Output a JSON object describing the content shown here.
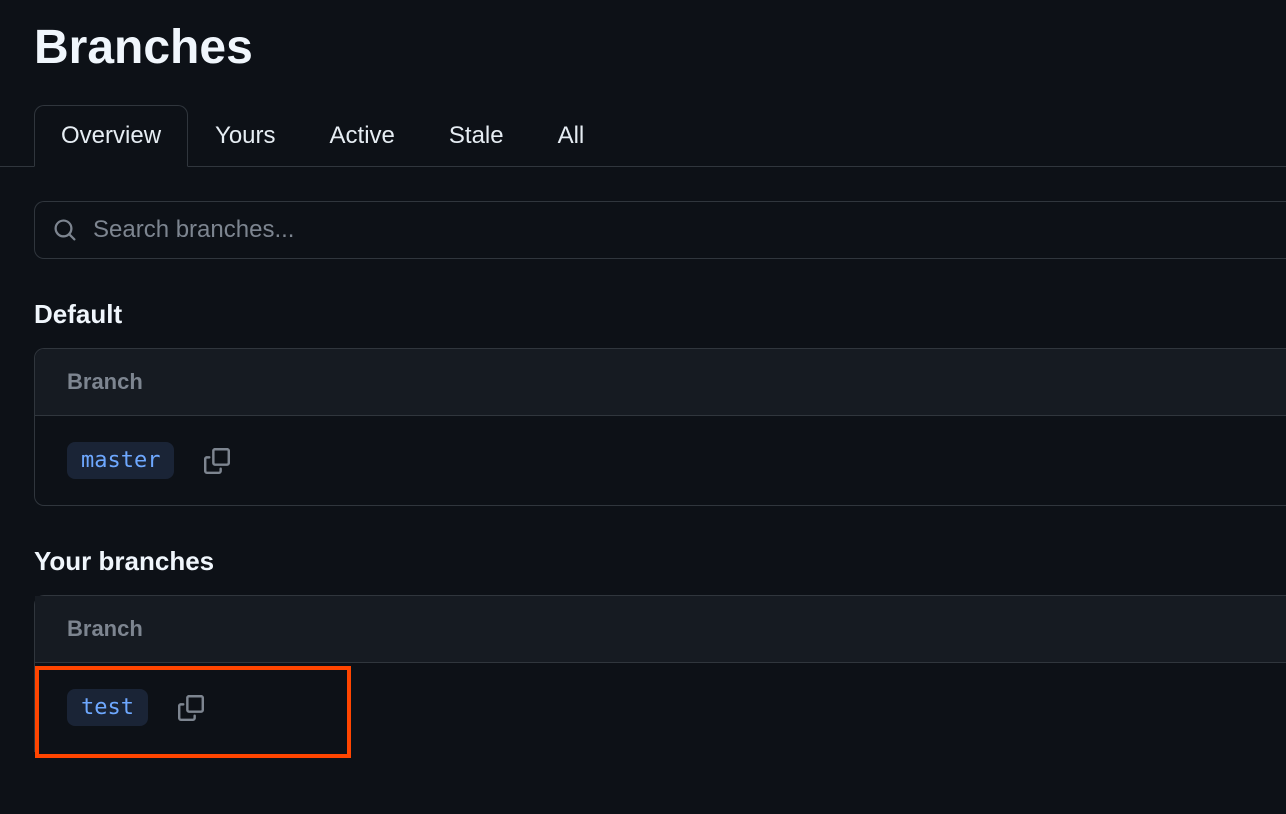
{
  "page": {
    "title": "Branches"
  },
  "tabs": [
    {
      "label": "Overview",
      "active": true
    },
    {
      "label": "Yours",
      "active": false
    },
    {
      "label": "Active",
      "active": false
    },
    {
      "label": "Stale",
      "active": false
    },
    {
      "label": "All",
      "active": false
    }
  ],
  "search": {
    "placeholder": "Search branches..."
  },
  "sections": {
    "default": {
      "title": "Default",
      "column_header": "Branch",
      "rows": [
        {
          "name": "master"
        }
      ]
    },
    "your_branches": {
      "title": "Your branches",
      "column_header": "Branch",
      "rows": [
        {
          "name": "test"
        }
      ]
    }
  }
}
